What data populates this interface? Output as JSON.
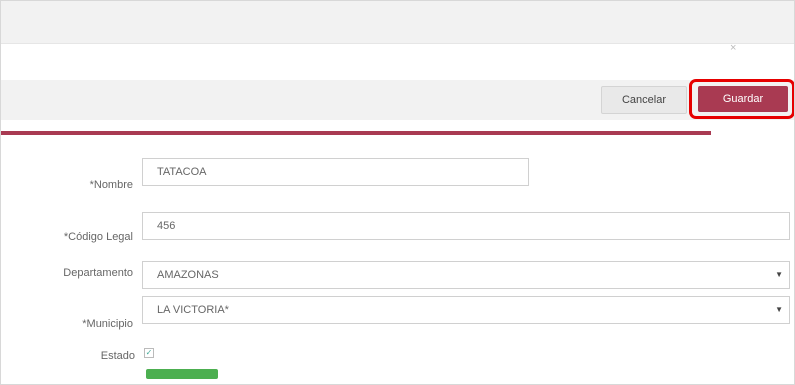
{
  "toolbar": {
    "close_glyph": "×",
    "cancel_label": "Cancelar",
    "save_label": "Guardar"
  },
  "form": {
    "nombre": {
      "label": "*Nombre",
      "value": "TATACOA"
    },
    "codigo_legal": {
      "label": "*Código Legal",
      "value": "456"
    },
    "departamento": {
      "label": "Departamento",
      "value": "AMAZONAS"
    },
    "municipio": {
      "label": "*Municipio",
      "value": "LA VICTORIA*"
    },
    "estado": {
      "label": "Estado"
    }
  },
  "colors": {
    "accent": "#a93a52",
    "highlight": "#e60000",
    "status": "#4caf50"
  }
}
